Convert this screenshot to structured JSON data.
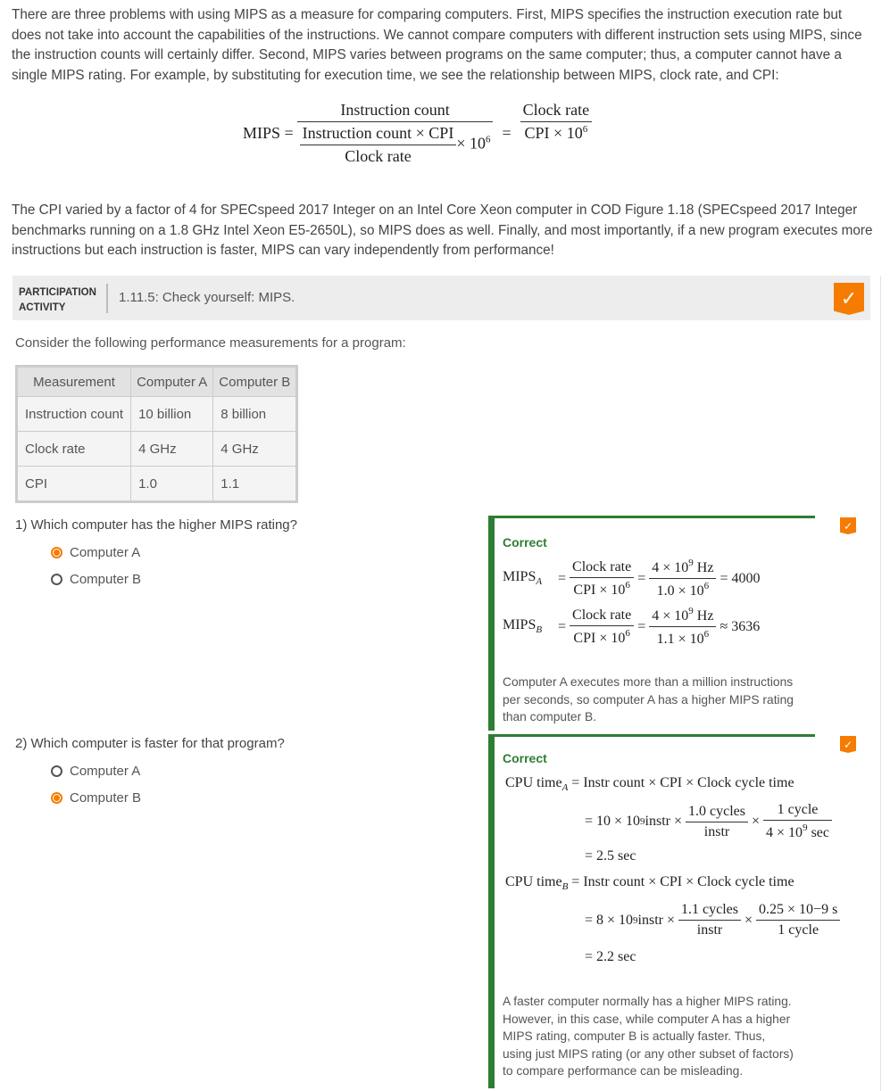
{
  "intro": "There are three problems with using MIPS as a measure for comparing computers. First, MIPS specifies the instruction execution rate but does not take into account the capabilities of the instructions. We cannot compare computers with different instruction sets using MIPS, since the instruction counts will certainly differ. Second, MIPS varies between programs on the same computer; thus, a computer cannot have a single MIPS rating. For example, by substituting for execution time, we see the relationship between MIPS, clock rate, and CPI:",
  "formula": {
    "lhs": "MIPS =",
    "num": "Instruction count",
    "den_num": "Instruction count × CPI",
    "den_den": "Clock rate",
    "times": "× 10",
    "exp": "6",
    "eq": "=",
    "r_num": "Clock rate",
    "r_den": "CPI × 10",
    "r_exp": "6"
  },
  "para2": "The CPI varied by a factor of 4 for SPECspeed 2017 Integer on an Intel Core Xeon computer in COD Figure 1.18 (SPECspeed 2017 Integer benchmarks running on a 1.8 GHz Intel Xeon E5-2650L), so MIPS does as well. Finally, and most importantly, if a new program executes more instructions but each instruction is faster, MIPS can vary independently from performance!",
  "activity": {
    "label_line1": "PARTICIPATION",
    "label_line2": "ACTIVITY",
    "title": "1.11.5: Check yourself: MIPS.",
    "prompt": "Consider the following performance measurements for a program:"
  },
  "table": {
    "headers": [
      "Measurement",
      "Computer A",
      "Computer B"
    ],
    "rows": [
      [
        "Instruction count",
        "10 billion",
        "8 billion"
      ],
      [
        "Clock rate",
        "4 GHz",
        "4 GHz"
      ],
      [
        "CPI",
        "1.0",
        "1.1"
      ]
    ]
  },
  "questions": [
    {
      "text": "1) Which computer has the higher MIPS rating?",
      "options": [
        "Computer A",
        "Computer B"
      ],
      "selected": 0,
      "feedback": {
        "status": "Correct",
        "explanation": "Computer A executes more than a million instructions per seconds, so computer A has a higher MIPS rating than computer B."
      }
    },
    {
      "text": "2) Which computer is faster for that program?",
      "options": [
        "Computer A",
        "Computer B"
      ],
      "selected": 1,
      "feedback": {
        "status": "Correct",
        "explanation": "A faster computer normally has a higher MIPS rating. However, in this case, while computer A has a higher MIPS rating, computer B is actually faster. Thus, using just MIPS rating (or any other subset of factors) to compare performance can be misleading."
      }
    }
  ],
  "math1": {
    "mips": "MIPS",
    "a": "A",
    "b": "B",
    "eq": "=",
    "clock": "Clock rate",
    "cpi": "CPI × 10",
    "six": "6",
    "hz": "4 × 10",
    "nine": "9",
    "hzu": " Hz",
    "dA": "1.0 × 10",
    "dB": "1.1 × 10",
    "resA": "= 4000",
    "resB": "≈ 3636"
  },
  "math2": {
    "cpu": "CPU time",
    "a": "A",
    "b": "B",
    "formula": "= Instr count × CPI × Clock cycle time",
    "lineA1": "= 10 × 10",
    "lineA1b": " instr ×",
    "nine": "9",
    "cycA": "1.0 cycles",
    "instr": "instr",
    "times": "×",
    "onecycle": "1 cycle",
    "fourE9": "4 × 10",
    "sec": " sec",
    "resA": "= 2.5 sec",
    "lineB1": "= 8 × 10",
    "cycB": "1.1 cycles",
    "q25": "0.25 × 10",
    "neg9": "−9 s",
    "resB": "= 2.2 sec"
  },
  "colors": {
    "accent": "#f57c00",
    "correct": "#2e7d32"
  }
}
